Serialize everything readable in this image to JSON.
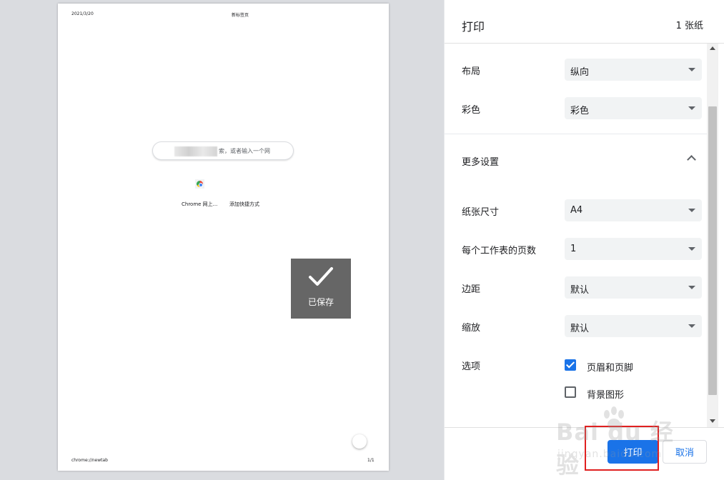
{
  "preview": {
    "header_date": "2021/3/20",
    "header_title": "新标签页",
    "search_placeholder_partial": "索，或者输入一个网",
    "shortcuts": [
      "Chrome 网上...",
      "添加快捷方式"
    ],
    "footer_url": "chrome://newtab",
    "footer_page": "1/1",
    "saved_toast": "已保存"
  },
  "panel": {
    "title": "打印",
    "sheet_count": "1 张纸",
    "layout": {
      "label": "布局",
      "value": "纵向"
    },
    "color": {
      "label": "彩色",
      "value": "彩色"
    },
    "more_settings": "更多设置",
    "paper_size": {
      "label": "纸张尺寸",
      "value": "A4"
    },
    "pages_per_sheet": {
      "label": "每个工作表的页数",
      "value": "1"
    },
    "margins": {
      "label": "边距",
      "value": "默认"
    },
    "scale": {
      "label": "缩放",
      "value": "默认"
    },
    "options": {
      "label": "选项",
      "headers_footers": {
        "label": "页眉和页脚",
        "checked": true
      },
      "background_graphics": {
        "label": "背景图形",
        "checked": false
      }
    },
    "print_button": "打印",
    "cancel_button": "取消"
  },
  "watermark": {
    "main": "Bai du 经验",
    "sub": "jingyan.baidu.com"
  },
  "colors": {
    "accent": "#1a73e8",
    "highlight_box": "#e02020",
    "toast_bg": "#666666"
  }
}
